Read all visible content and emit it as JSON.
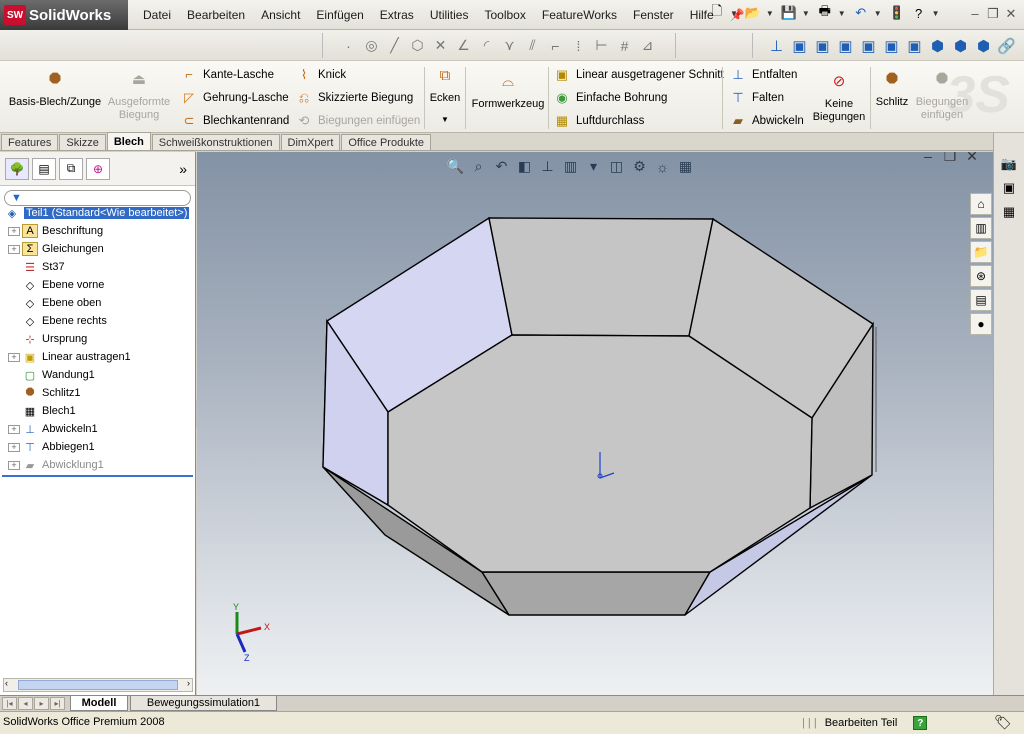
{
  "app": {
    "logo": "SolidWorks",
    "logo_mark": "SW"
  },
  "menu": [
    "Datei",
    "Bearbeiten",
    "Ansicht",
    "Einfügen",
    "Extras",
    "Utilities",
    "Toolbox",
    "FeatureWorks",
    "Fenster",
    "Hilfe"
  ],
  "commandmanager": {
    "basis_blech": "Basis-Blech/Zunge",
    "ausgeformte_biegung": "Ausgeformte Biegung",
    "kante_lasche": "Kante-Lasche",
    "gehrung_lasche": "Gehrung-Lasche",
    "blechkantenrand": "Blechkantenrand",
    "knick": "Knick",
    "skizzierte_biegung": "Skizzierte Biegung",
    "biegungen_einfuegen_small": "Biegungen einfügen",
    "ecken": "Ecken",
    "formwerkzeug": "Formwerkzeug",
    "linear_schnitt": "Linear ausgetragener Schnitt",
    "einfache_bohrung": "Einfache Bohrung",
    "luftdurchlass": "Luftdurchlass",
    "entfalten": "Entfalten",
    "falten": "Falten",
    "abwickeln": "Abwickeln",
    "keine_biegungen": "Keine Biegungen",
    "schlitz": "Schlitz",
    "biegungen_einfuegen": "Biegungen einfügen"
  },
  "tabs": [
    {
      "label": "Features",
      "active": false
    },
    {
      "label": "Skizze",
      "active": false
    },
    {
      "label": "Blech",
      "active": true
    },
    {
      "label": "Schweißkonstruktionen",
      "active": false
    },
    {
      "label": "DimXpert",
      "active": false
    },
    {
      "label": "Office Produkte",
      "active": false
    }
  ],
  "tree": {
    "root": "Teil1  (Standard<Wie bearbeitet>)",
    "items": [
      {
        "label": "Beschriftung",
        "expandable": true,
        "icon": "annotation-icon"
      },
      {
        "label": "Gleichungen",
        "expandable": true,
        "icon": "sigma-icon"
      },
      {
        "label": "St37",
        "expandable": false,
        "icon": "material-icon"
      },
      {
        "label": "Ebene vorne",
        "expandable": false,
        "icon": "plane-icon"
      },
      {
        "label": "Ebene oben",
        "expandable": false,
        "icon": "plane-icon"
      },
      {
        "label": "Ebene rechts",
        "expandable": false,
        "icon": "plane-icon"
      },
      {
        "label": "Ursprung",
        "expandable": false,
        "icon": "origin-icon"
      },
      {
        "label": "Linear austragen1",
        "expandable": true,
        "icon": "extrude-icon"
      },
      {
        "label": "Wandung1",
        "expandable": false,
        "icon": "shell-icon"
      },
      {
        "label": "Schlitz1",
        "expandable": false,
        "icon": "rip-icon"
      },
      {
        "label": "Blech1",
        "expandable": false,
        "icon": "sheetmetal-icon"
      },
      {
        "label": "Abwickeln1",
        "expandable": true,
        "icon": "unfold-icon"
      },
      {
        "label": "Abbiegen1",
        "expandable": true,
        "icon": "fold-icon"
      },
      {
        "label": "Abwicklung1",
        "expandable": true,
        "icon": "flatpattern-icon",
        "suppressed": true
      }
    ]
  },
  "bottom_tabs": [
    {
      "label": "Modell",
      "active": true
    },
    {
      "label": "Bewegungssimulation1",
      "active": false
    }
  ],
  "status": {
    "product": "SolidWorks Office Premium 2008",
    "mode": "Bearbeiten Teil",
    "help": "?"
  },
  "triad": {
    "x": "X",
    "y": "Y",
    "z": "Z"
  },
  "colors": {
    "selection": "#316ac5",
    "face_top": "#d5d9f3",
    "face_grey": "#c9c9c9",
    "accent_red": "#c8102e"
  }
}
